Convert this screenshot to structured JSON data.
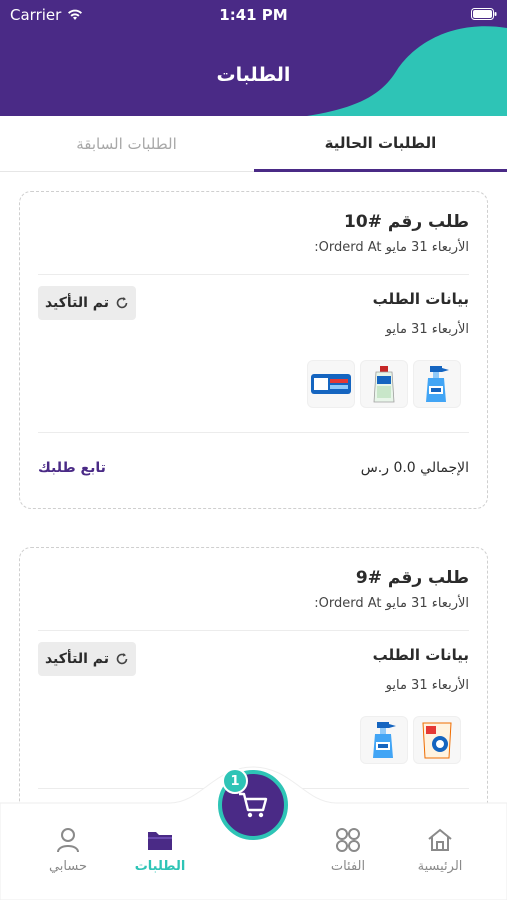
{
  "status_bar": {
    "carrier": "Carrier",
    "time": "1:41 PM"
  },
  "header": {
    "title": "الطلبات"
  },
  "tabs": {
    "current": "الطلبات الحالية",
    "previous": "الطلبات السابقة"
  },
  "orders": [
    {
      "title": "طلب رقم #10",
      "ordered_at": "الأربعاء 31 مايو Orderd At:",
      "details_label": "بيانات الطلب",
      "details_date": "الأربعاء 31 مايو",
      "status": "تم التأكيد",
      "products": [
        "spray-bottle-product",
        "cleaner-bottle-product",
        "wipes-pack-product"
      ],
      "total": "الإجمالي 0.0 ر.س",
      "track_label": "تابع طلبك"
    },
    {
      "title": "طلب رقم #9",
      "ordered_at": "الأربعاء 31 مايو Orderd At:",
      "details_label": "بيانات الطلب",
      "details_date": "الأربعاء 31 مايو",
      "status": "تم التأكيد",
      "products": [
        "detergent-pack-product",
        "spray-bottle-product"
      ]
    }
  ],
  "cart": {
    "badge": "1"
  },
  "bottom_nav": {
    "home": "الرئيسية",
    "categories": "الفئات",
    "orders": "الطلبات",
    "account": "حسابي"
  },
  "colors": {
    "primary": "#4a2a86",
    "accent": "#2ec4b6"
  }
}
